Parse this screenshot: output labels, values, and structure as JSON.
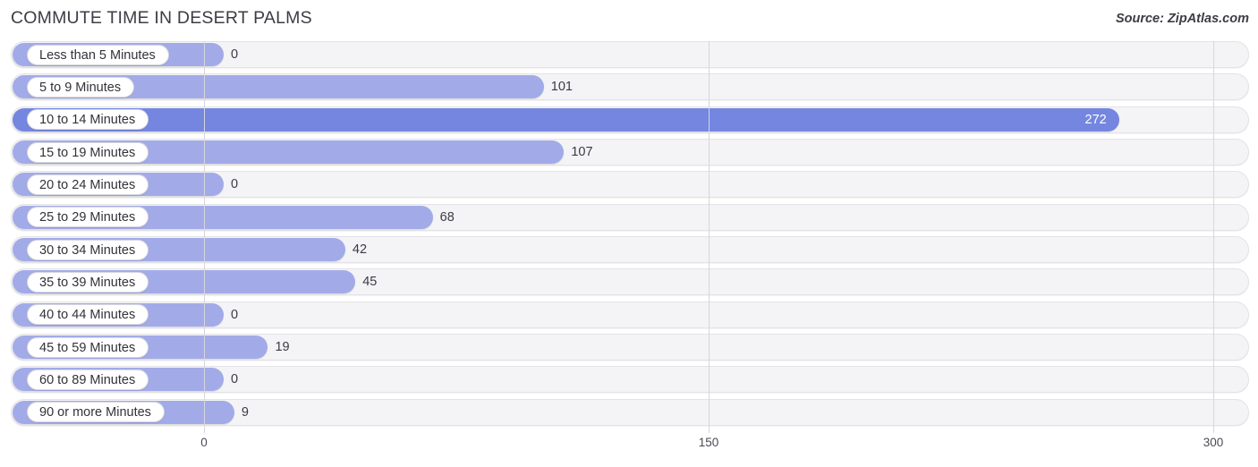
{
  "header": {
    "title": "COMMUTE TIME IN DESERT PALMS",
    "source": "Source: ZipAtlas.com"
  },
  "colors": {
    "bar": "#a2abe8",
    "bar_max": "#7486e0",
    "track": "#f4f4f6",
    "gridline": "#d6d6dc",
    "text": "#3a3a44"
  },
  "chart_data": {
    "type": "bar",
    "orientation": "horizontal",
    "title": "COMMUTE TIME IN DESERT PALMS",
    "xlabel": "",
    "ylabel": "",
    "xlim": [
      0,
      300
    ],
    "ticks": [
      "0",
      "150",
      "300"
    ],
    "tick_values": [
      0,
      150,
      300
    ],
    "grid": true,
    "legend": false,
    "categories": [
      "Less than 5 Minutes",
      "5 to 9 Minutes",
      "10 to 14 Minutes",
      "15 to 19 Minutes",
      "20 to 24 Minutes",
      "25 to 29 Minutes",
      "30 to 34 Minutes",
      "35 to 39 Minutes",
      "40 to 44 Minutes",
      "45 to 59 Minutes",
      "60 to 89 Minutes",
      "90 or more Minutes"
    ],
    "values": [
      0,
      101,
      272,
      107,
      0,
      68,
      42,
      45,
      0,
      19,
      0,
      9
    ],
    "value_labels": [
      "0",
      "101",
      "272",
      "107",
      "0",
      "68",
      "42",
      "45",
      "0",
      "19",
      "0",
      "9"
    ]
  },
  "rows": [
    {
      "label": "Less than 5 Minutes",
      "value": 0,
      "value_label": "0",
      "max": false
    },
    {
      "label": "5 to 9 Minutes",
      "value": 101,
      "value_label": "101",
      "max": false
    },
    {
      "label": "10 to 14 Minutes",
      "value": 272,
      "value_label": "272",
      "max": true
    },
    {
      "label": "15 to 19 Minutes",
      "value": 107,
      "value_label": "107",
      "max": false
    },
    {
      "label": "20 to 24 Minutes",
      "value": 0,
      "value_label": "0",
      "max": false
    },
    {
      "label": "25 to 29 Minutes",
      "value": 68,
      "value_label": "68",
      "max": false
    },
    {
      "label": "30 to 34 Minutes",
      "value": 42,
      "value_label": "42",
      "max": false
    },
    {
      "label": "35 to 39 Minutes",
      "value": 45,
      "value_label": "45",
      "max": false
    },
    {
      "label": "40 to 44 Minutes",
      "value": 0,
      "value_label": "0",
      "max": false
    },
    {
      "label": "45 to 59 Minutes",
      "value": 19,
      "value_label": "19",
      "max": false
    },
    {
      "label": "60 to 89 Minutes",
      "value": 0,
      "value_label": "0",
      "max": false
    },
    {
      "label": "90 or more Minutes",
      "value": 9,
      "value_label": "9",
      "max": false
    }
  ],
  "axis": {
    "ticks": [
      {
        "label": "0",
        "value": 0
      },
      {
        "label": "150",
        "value": 150
      },
      {
        "label": "300",
        "value": 300
      }
    ]
  }
}
